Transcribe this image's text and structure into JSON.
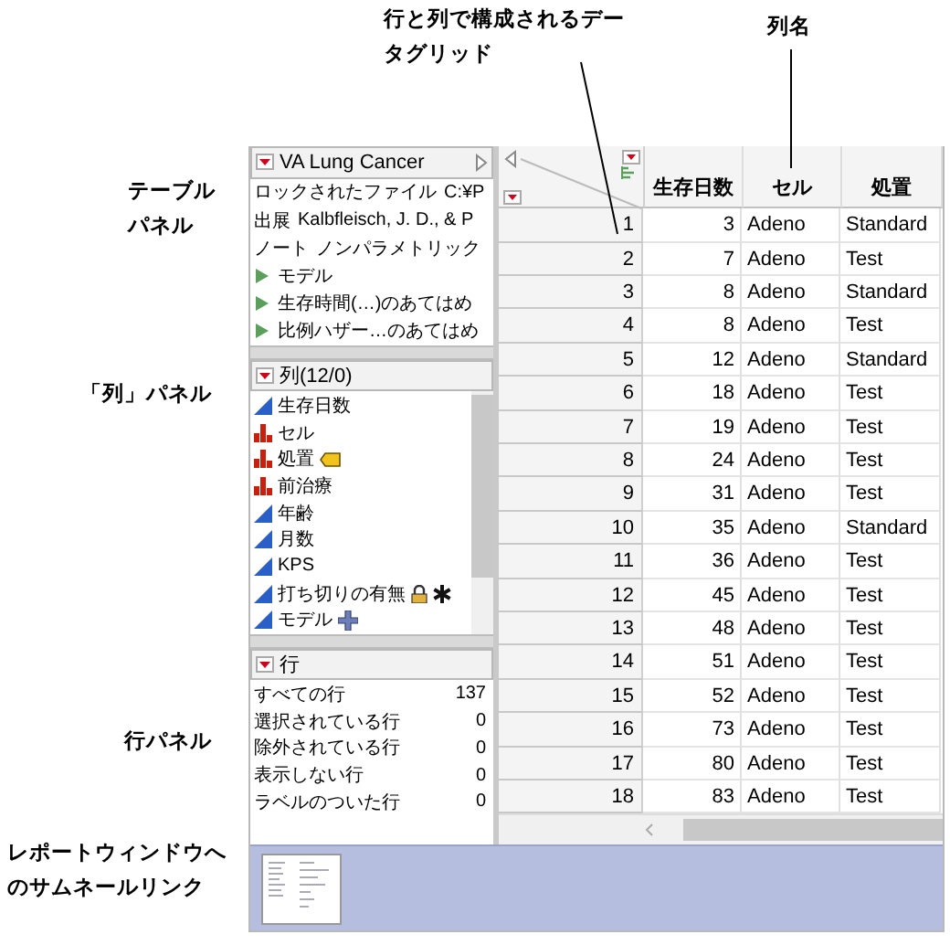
{
  "callouts": {
    "top": [
      {
        "text": "行と列で構成されるデータグリッド"
      },
      {
        "text": "列名"
      }
    ],
    "side": [
      {
        "text": "テーブルパネル"
      },
      {
        "text": "「列」パネル"
      },
      {
        "text": "行パネル"
      },
      {
        "text": "レポートウィンドウへのサムネールリンク"
      }
    ]
  },
  "table_panel": {
    "title": "VA Lung Cancer",
    "items": [
      {
        "kind": "property",
        "label": "ロックされたファイル",
        "value": "C:¥P"
      },
      {
        "kind": "property",
        "label": "出展",
        "value": "Kalbfleisch, J. D., & P"
      },
      {
        "kind": "property",
        "label": "ノート",
        "value": "ノンパラメトリック"
      },
      {
        "kind": "script",
        "label": "モデル"
      },
      {
        "kind": "script",
        "label": "生存時間(…)のあてはめ"
      },
      {
        "kind": "script",
        "label": "比例ハザー…のあてはめ"
      }
    ]
  },
  "columns_panel": {
    "title": "列(12/0)",
    "items": [
      {
        "kind": "continuous",
        "name": "生存日数",
        "value_labels": false,
        "locked": false,
        "role": false,
        "formula": false
      },
      {
        "kind": "nominal",
        "name": "セル",
        "value_labels": false,
        "locked": false,
        "role": false,
        "formula": false
      },
      {
        "kind": "nominal",
        "name": "処置",
        "value_labels": true,
        "locked": false,
        "role": false,
        "formula": false
      },
      {
        "kind": "nominal",
        "name": "前治療",
        "value_labels": false,
        "locked": false,
        "role": false,
        "formula": false
      },
      {
        "kind": "continuous",
        "name": "年齢",
        "value_labels": false,
        "locked": false,
        "role": false,
        "formula": false
      },
      {
        "kind": "continuous",
        "name": "月数",
        "value_labels": false,
        "locked": false,
        "role": false,
        "formula": false
      },
      {
        "kind": "continuous",
        "name": "KPS",
        "value_labels": false,
        "locked": false,
        "role": false,
        "formula": false
      },
      {
        "kind": "continuous",
        "name": "打ち切りの有無",
        "value_labels": false,
        "locked": true,
        "role": true,
        "formula": false
      },
      {
        "kind": "continuous",
        "name": "モデル",
        "value_labels": false,
        "locked": false,
        "role": false,
        "formula": true
      }
    ]
  },
  "rows_panel": {
    "title": "行",
    "items": [
      {
        "label": "すべての行",
        "count": "137"
      },
      {
        "label": "選択されている行",
        "count": "0"
      },
      {
        "label": "除外されている行",
        "count": "0"
      },
      {
        "label": "表示しない行",
        "count": "0"
      },
      {
        "label": "ラベルのついた行",
        "count": "0"
      }
    ]
  },
  "grid": {
    "columns": [
      "生存日数",
      "セル",
      "処置"
    ],
    "rows": [
      {
        "n": "1",
        "cells": [
          "3",
          "Adeno",
          "Standard"
        ]
      },
      {
        "n": "2",
        "cells": [
          "7",
          "Adeno",
          "Test"
        ]
      },
      {
        "n": "3",
        "cells": [
          "8",
          "Adeno",
          "Standard"
        ]
      },
      {
        "n": "4",
        "cells": [
          "8",
          "Adeno",
          "Test"
        ]
      },
      {
        "n": "5",
        "cells": [
          "12",
          "Adeno",
          "Standard"
        ]
      },
      {
        "n": "6",
        "cells": [
          "18",
          "Adeno",
          "Test"
        ]
      },
      {
        "n": "7",
        "cells": [
          "19",
          "Adeno",
          "Test"
        ]
      },
      {
        "n": "8",
        "cells": [
          "24",
          "Adeno",
          "Test"
        ]
      },
      {
        "n": "9",
        "cells": [
          "31",
          "Adeno",
          "Test"
        ]
      },
      {
        "n": "10",
        "cells": [
          "35",
          "Adeno",
          "Standard"
        ]
      },
      {
        "n": "11",
        "cells": [
          "36",
          "Adeno",
          "Test"
        ]
      },
      {
        "n": "12",
        "cells": [
          "45",
          "Adeno",
          "Test"
        ]
      },
      {
        "n": "13",
        "cells": [
          "48",
          "Adeno",
          "Test"
        ]
      },
      {
        "n": "14",
        "cells": [
          "51",
          "Adeno",
          "Test"
        ]
      },
      {
        "n": "15",
        "cells": [
          "52",
          "Adeno",
          "Test"
        ]
      },
      {
        "n": "16",
        "cells": [
          "73",
          "Adeno",
          "Test"
        ]
      },
      {
        "n": "17",
        "cells": [
          "80",
          "Adeno",
          "Test"
        ]
      },
      {
        "n": "18",
        "cells": [
          "83",
          "Adeno",
          "Test"
        ]
      }
    ]
  }
}
